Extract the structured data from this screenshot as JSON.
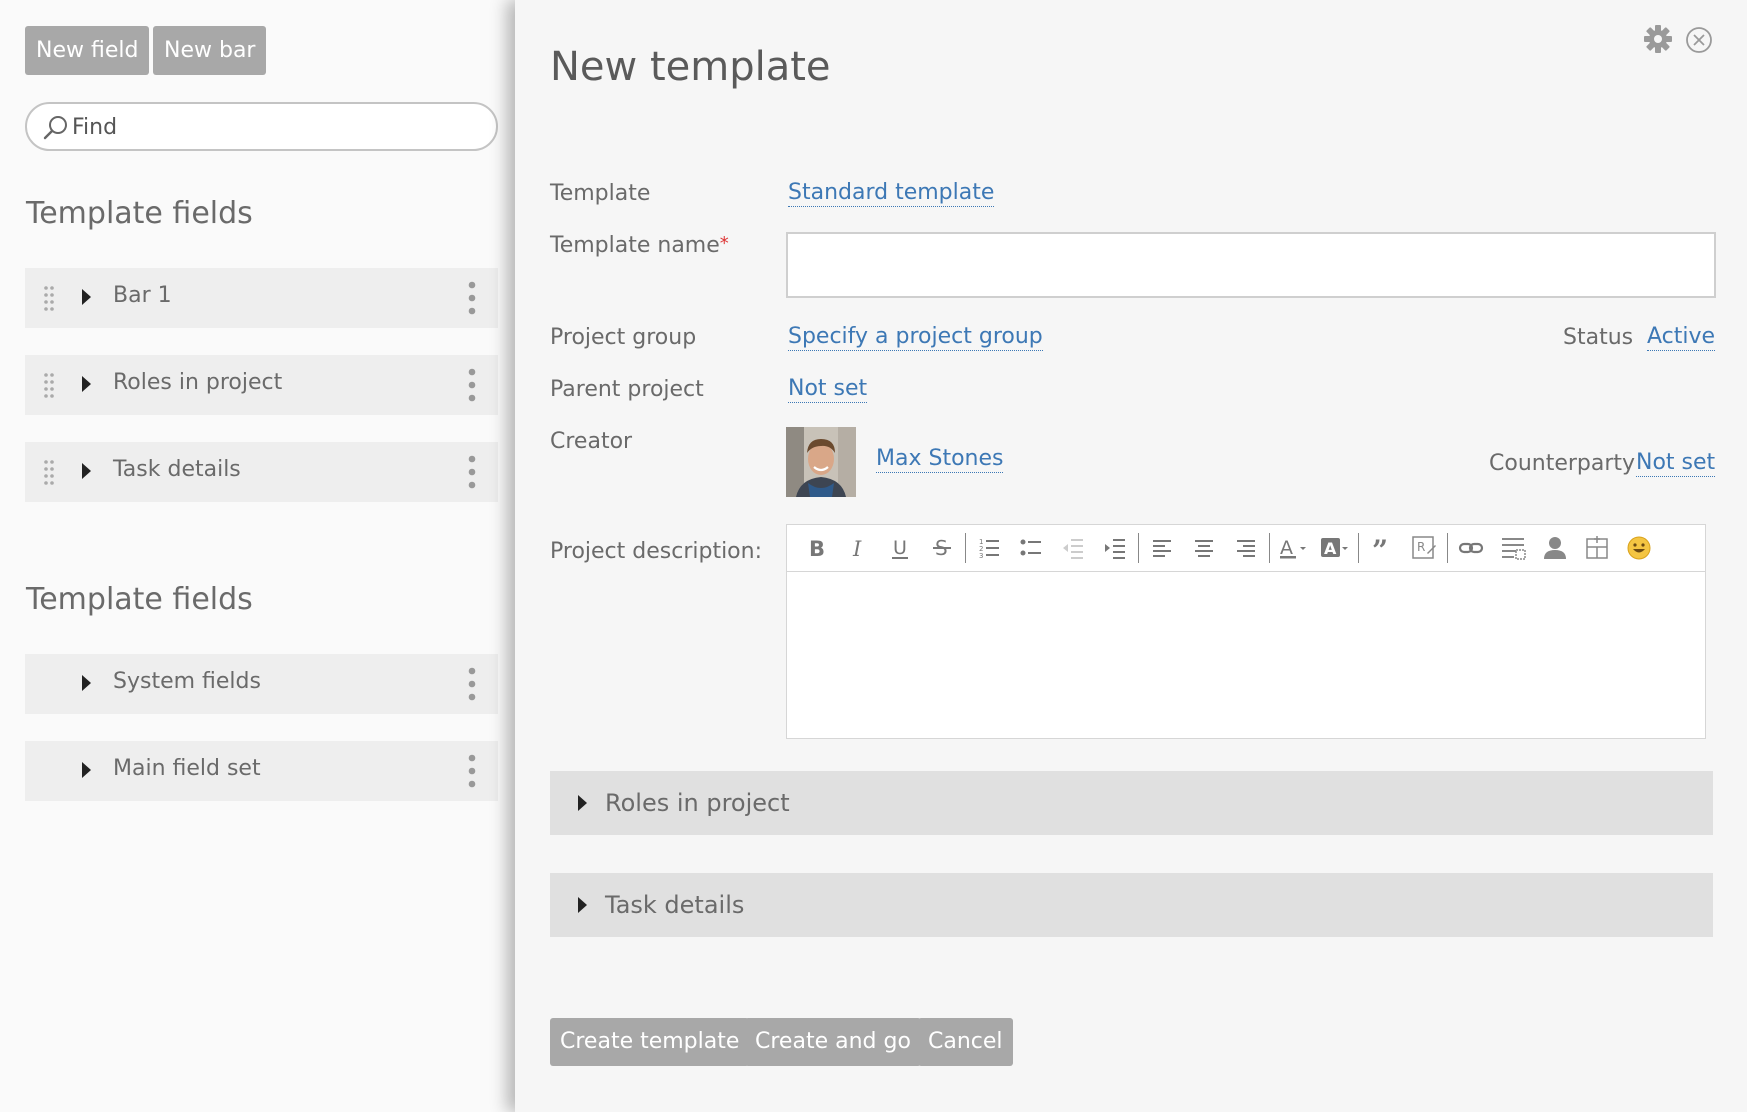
{
  "left": {
    "buttons": {
      "new_field": "New field",
      "new_bar": "New bar"
    },
    "search": {
      "placeholder": "Find"
    },
    "section1": {
      "title": "Template fields",
      "items": [
        {
          "label": "Bar 1"
        },
        {
          "label": "Roles in project"
        },
        {
          "label": "Task details"
        }
      ]
    },
    "section2": {
      "title": "Template fields",
      "items": [
        {
          "label": "System fields"
        },
        {
          "label": "Main field set"
        }
      ]
    }
  },
  "dialog": {
    "title": "New template",
    "fields": {
      "template_label": "Template",
      "template_value": "Standard template",
      "template_name_label": "Template name",
      "template_name_required": "*",
      "template_name_value": "",
      "project_group_label": "Project group",
      "project_group_value": "Specify a project group",
      "status_label": "Status",
      "status_value": "Active",
      "parent_project_label": "Parent project",
      "parent_project_value": "Not set",
      "creator_label": "Creator",
      "creator_value": "Max Stones",
      "counterparty_label": "Counterparty",
      "counterparty_value": "Not set",
      "description_label": "Project description:"
    },
    "toolbar_icons": [
      "bold-icon",
      "italic-icon",
      "underline-icon",
      "strikethrough-icon",
      "ordered-list-icon",
      "unordered-list-icon",
      "outdent-icon",
      "indent-icon",
      "align-left-icon",
      "align-center-icon",
      "align-right-icon",
      "text-color-icon",
      "background-color-icon",
      "quote-icon",
      "source-icon",
      "link-icon",
      "insert-field-icon",
      "insert-user-icon",
      "insert-table-icon",
      "emoji-icon"
    ],
    "panels": [
      {
        "label": "Roles in project"
      },
      {
        "label": "Task details"
      }
    ],
    "actions": {
      "create": "Create template",
      "create_go": "Create and go",
      "cancel": "Cancel"
    }
  },
  "colors": {
    "link": "#3d78b5",
    "button_gray": "#a8a8a8",
    "required": "#dd3333"
  }
}
